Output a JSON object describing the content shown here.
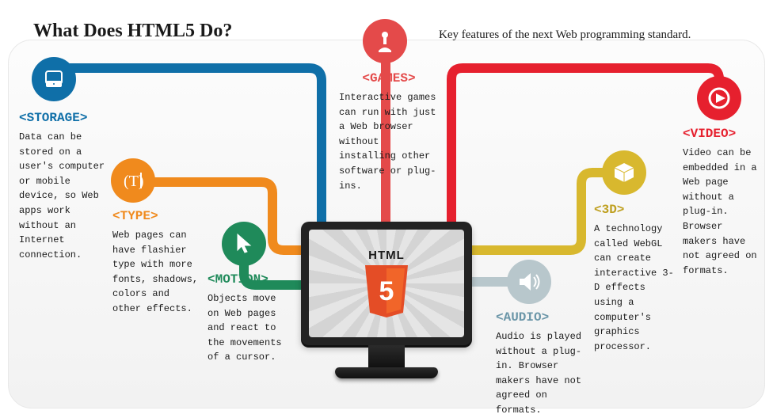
{
  "header": {
    "title": "What Does HTML5 Do?",
    "subtitle": "Key features of the next Web programming standard."
  },
  "monitor": {
    "label": "HTML",
    "badge_number": "5"
  },
  "features": {
    "storage": {
      "tag": "<STORAGE>",
      "desc": "Data can be stored on a user's computer or mobile device, so Web apps work without an Internet connection.",
      "color": "#0f6fa8"
    },
    "type": {
      "tag": "<TYPE>",
      "desc": "Web pages can have flashier type with more fonts, shadows, colors and other effects.",
      "color": "#f08a1d"
    },
    "motion": {
      "tag": "<MOTION>",
      "desc": "Objects move on Web pages and react to the movements of a cursor.",
      "color": "#1f8a5a"
    },
    "games": {
      "tag": "<GAMES>",
      "desc": "Interactive games can run with just a Web browser without installing other software or plug-ins.",
      "color": "#e44a4a"
    },
    "audio": {
      "tag": "<AUDIO>",
      "desc": "Audio is played without a plug-in. Browser makers have not agreed on formats.",
      "color": "#b8c7cc"
    },
    "threeD": {
      "tag": "<3D>",
      "desc": "A technology called WebGL can create interactive 3-D effects using a computer's graphics processor.",
      "color": "#d8b82e"
    },
    "video": {
      "tag": "<VIDEO>",
      "desc": "Video can be embedded in a Web page without a plug-in. Browser makers have not agreed on formats.",
      "color": "#e6202e"
    }
  }
}
